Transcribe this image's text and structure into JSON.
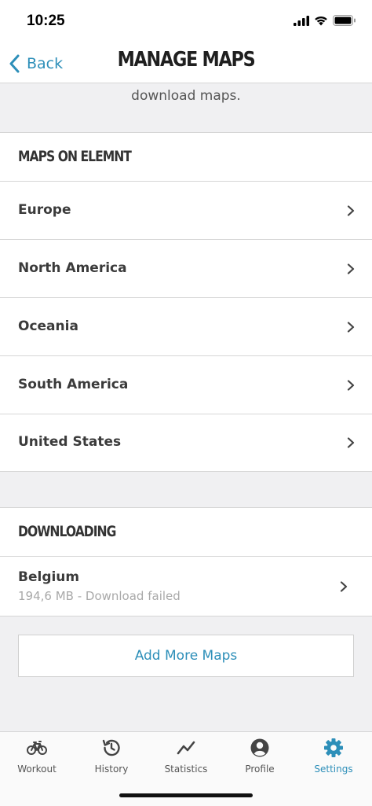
{
  "status_bar": {
    "time": "10:25"
  },
  "nav": {
    "back_label": "Back",
    "title": "MANAGE MAPS"
  },
  "info": {
    "text": "download maps."
  },
  "sections": {
    "maps_on_elemnt": "MAPS ON ELEMNT",
    "downloading": "DOWNLOADING"
  },
  "maps": [
    {
      "label": "Europe"
    },
    {
      "label": "North America"
    },
    {
      "label": "Oceania"
    },
    {
      "label": "South America"
    },
    {
      "label": "United States"
    }
  ],
  "downloads": [
    {
      "label": "Belgium",
      "status": "194,6 MB - Download failed"
    }
  ],
  "add_more_label": "Add More Maps",
  "tabs": [
    {
      "label": "Workout",
      "icon": "bicycle-icon"
    },
    {
      "label": "History",
      "icon": "history-icon"
    },
    {
      "label": "Statistics",
      "icon": "statistics-icon"
    },
    {
      "label": "Profile",
      "icon": "profile-icon"
    },
    {
      "label": "Settings",
      "icon": "gear-icon",
      "active": true
    }
  ],
  "colors": {
    "accent": "#2d8fb9",
    "background_gray": "#f0f0f2",
    "text": "#3b3b3b"
  }
}
